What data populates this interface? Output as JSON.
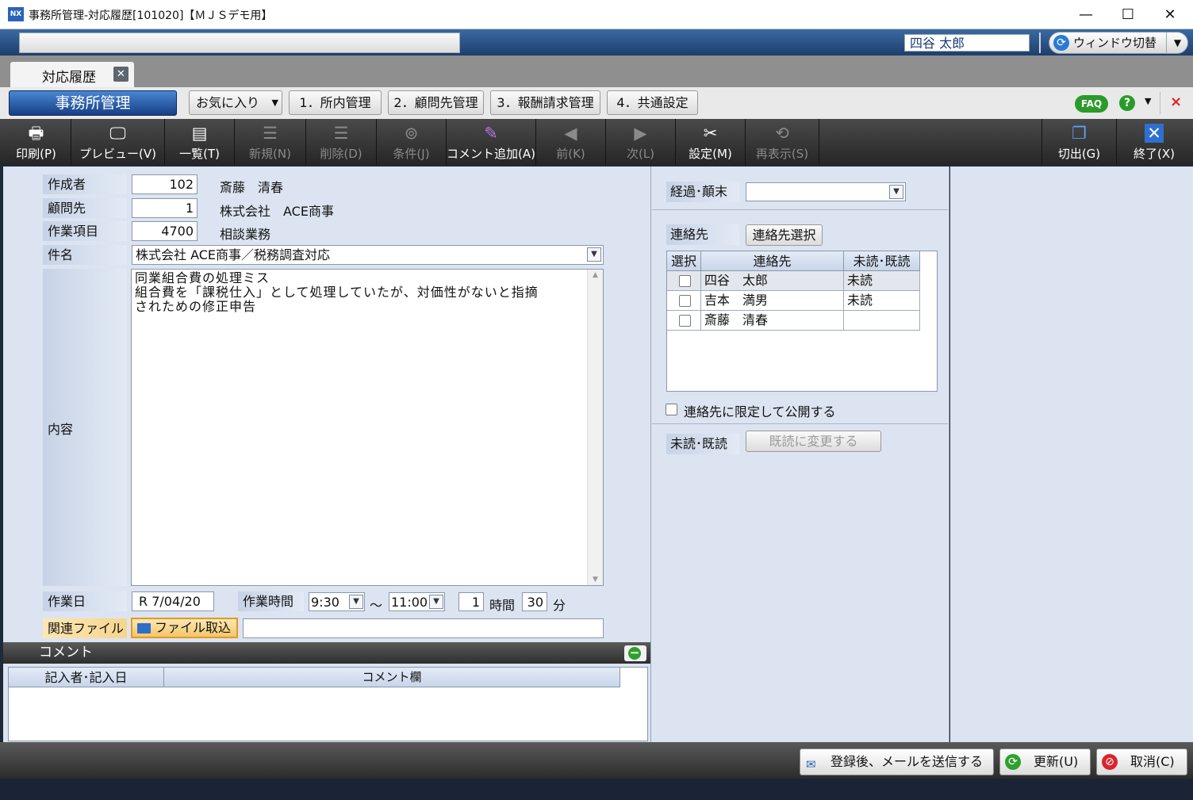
{
  "window": {
    "app_icon": "NX",
    "title": "事務所管理-対応履歴[101020]【ＭＪＳデモ用】",
    "minimize": "—",
    "maximize": "☐",
    "close": "✕"
  },
  "header": {
    "user_name": "四谷 太郎",
    "window_switch_label": "ウィンドウ切替",
    "window_switch_caret": "▼"
  },
  "tabs": [
    {
      "label": "対応履歴",
      "close": "✕"
    }
  ],
  "menu": {
    "office_title": "事務所管理",
    "favorites": "お気に入り",
    "items": [
      "1．所内管理",
      "2．顧問先管理",
      "3．報酬請求管理",
      "4．共通設定"
    ],
    "faq": "FAQ",
    "help": "?",
    "close": "×"
  },
  "toolbar": [
    {
      "label": "印刷(P)",
      "icon": "printer-icon",
      "enabled": true
    },
    {
      "label": "プレビュー(V)",
      "icon": "monitor-icon",
      "enabled": true
    },
    {
      "label": "一覧(T)",
      "icon": "list-icon",
      "enabled": true
    },
    {
      "label": "新規(N)",
      "icon": "new-icon",
      "enabled": false
    },
    {
      "label": "削除(D)",
      "icon": "delete-icon",
      "enabled": false
    },
    {
      "label": "条件(J)",
      "icon": "binoculars-icon",
      "enabled": false
    },
    {
      "label": "コメント追加(A)",
      "icon": "add-comment-icon",
      "enabled": true
    },
    {
      "label": "前(K)",
      "icon": "prev-icon",
      "enabled": false
    },
    {
      "label": "次(L)",
      "icon": "next-icon",
      "enabled": false
    },
    {
      "label": "設定(M)",
      "icon": "tools-icon",
      "enabled": true
    },
    {
      "label": "再表示(S)",
      "icon": "refresh-display-icon",
      "enabled": false
    },
    {
      "label": "切出(G)",
      "icon": "cut-out-icon",
      "enabled": true
    },
    {
      "label": "終了(X)",
      "icon": "exit-icon",
      "enabled": true
    }
  ],
  "form": {
    "author_label": "作成者",
    "author_code": "102",
    "author_name": "斎藤　清春",
    "client_label": "顧問先",
    "client_code": "1",
    "client_name": "株式会社　ACE商事",
    "task_label": "作業項目",
    "task_code": "4700",
    "task_name": "相談業務",
    "subject_label": "件名",
    "subject_value": "株式会社 ACE商事／税務調査対応",
    "content_label": "内容",
    "content_lines": [
      "同業組合費の処理ミス",
      "組合費を「課税仕入」として処理していたが、対価性がないと指摘",
      "されための修正申告"
    ],
    "work_date_label": "作業日",
    "work_date_value": "R  7/04/20",
    "work_time_label": "作業時間",
    "start_time": "9:30",
    "tilde": "～",
    "end_time": "11:00",
    "hours_value": "1",
    "hours_unit": "時間",
    "minutes_value": "30",
    "minutes_unit": "分",
    "related_file_label": "関連ファイル",
    "file_import_label": "ファイル取込",
    "file_path_value": ""
  },
  "comments": {
    "section_title": "コメント",
    "col_author_date": "記入者･記入日",
    "col_comment": "コメント欄",
    "minimize": "−"
  },
  "right": {
    "progress_label": "経過･顛末",
    "progress_value": "",
    "contacts_label": "連絡先",
    "contacts_select_button": "連絡先選択",
    "grid_headers": [
      "選択",
      "連絡先",
      "未読･既読"
    ],
    "contacts": [
      {
        "name": "四谷　太郎",
        "status": "未読"
      },
      {
        "name": "吉本　満男",
        "status": "未読"
      },
      {
        "name": "斎藤　清春",
        "status": ""
      }
    ],
    "limit_public_label": "連絡先に限定して公開する",
    "read_label": "未読･既読",
    "mark_read_button": "既読に変更する"
  },
  "actions": {
    "register_mail": "登録後、メールを送信する",
    "update": "更新(U)",
    "cancel": "取消(C)"
  },
  "colors": {
    "panel_bg": "#dce4f1",
    "accent_blue": "#1e4f99",
    "toolbar_bg": "#333333",
    "highlight_orange": "#f3c66a"
  }
}
